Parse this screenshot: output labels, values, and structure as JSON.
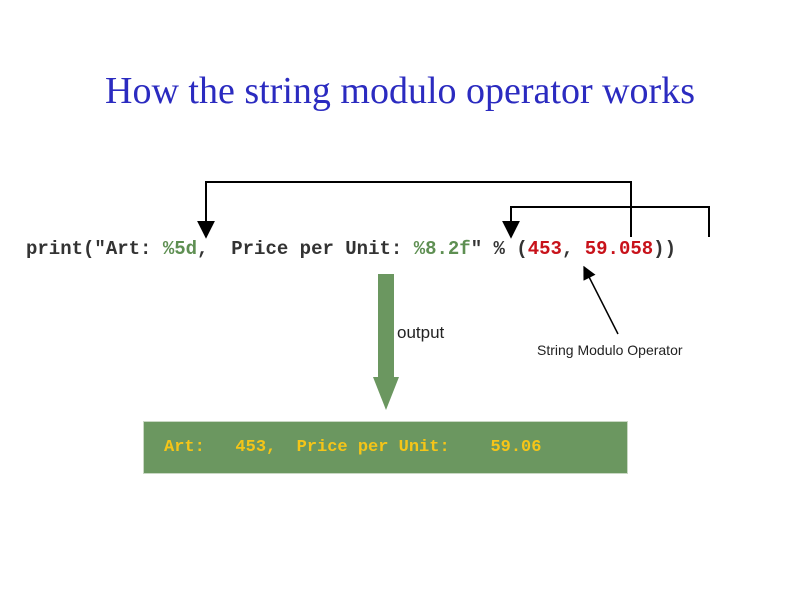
{
  "title": "How the string modulo operator works",
  "code": {
    "prefix": "print(\"Art: ",
    "spec1": "%5d",
    "middle": ",  Price per Unit: ",
    "spec2": "%8.2f",
    "operator_part": "\" % (",
    "value1": "453",
    "comma": ", ",
    "value2": "59.058",
    "suffix": "))"
  },
  "labels": {
    "output": "output",
    "operator": "String Modulo Operator"
  },
  "output_line": "Art:   453,  Price per Unit:    59.06",
  "colors": {
    "title": "#2b2bc0",
    "format_spec": "#5e8f52",
    "values": "#c8121a",
    "output_box": "#6b9760",
    "output_text": "#f5c518"
  }
}
